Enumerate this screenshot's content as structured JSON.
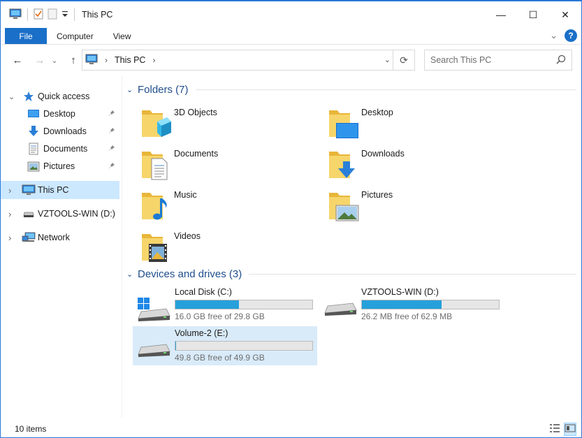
{
  "window": {
    "title": "This PC",
    "controls": {
      "minimize": "—",
      "maximize": "☐",
      "close": "✕"
    }
  },
  "ribbon": {
    "tabs": [
      "File",
      "Computer",
      "View"
    ],
    "expand_glyph": "⌄",
    "help_glyph": "?"
  },
  "nav": {
    "back": "←",
    "forward": "→",
    "recent": "⌄",
    "up": "↑",
    "address_crumb": "This PC",
    "address_dropdown": "⌄",
    "refresh": "⟳",
    "search_placeholder": "Search This PC"
  },
  "sidebar": {
    "items": [
      {
        "label": "Quick access",
        "icon": "star-icon",
        "chevron": "⌄",
        "pinned": false
      },
      {
        "label": "Desktop",
        "icon": "desktop-icon",
        "chevron": "",
        "pinned": true
      },
      {
        "label": "Downloads",
        "icon": "download-icon",
        "chevron": "",
        "pinned": true
      },
      {
        "label": "Documents",
        "icon": "document-icon",
        "chevron": "",
        "pinned": true
      },
      {
        "label": "Pictures",
        "icon": "pictures-icon",
        "chevron": "",
        "pinned": true
      },
      {
        "label": "This PC",
        "icon": "computer-icon",
        "chevron": "›",
        "pinned": false,
        "selected": true
      },
      {
        "label": "VZTOOLS-WIN (D:)",
        "icon": "drive-icon",
        "chevron": "›",
        "pinned": false
      },
      {
        "label": "Network",
        "icon": "network-icon",
        "chevron": "›",
        "pinned": false
      }
    ],
    "pin_glyph": "📌"
  },
  "content": {
    "folders_header": "Folders (7)",
    "folders": [
      {
        "label": "3D Objects",
        "icon": "3d-objects-icon"
      },
      {
        "label": "Desktop",
        "icon": "desktop-folder-icon"
      },
      {
        "label": "Documents",
        "icon": "documents-folder-icon"
      },
      {
        "label": "Downloads",
        "icon": "downloads-folder-icon"
      },
      {
        "label": "Music",
        "icon": "music-folder-icon"
      },
      {
        "label": "Pictures",
        "icon": "pictures-folder-icon"
      },
      {
        "label": "Videos",
        "icon": "videos-folder-icon"
      }
    ],
    "drives_header": "Devices and drives (3)",
    "drives": [
      {
        "label": "Local Disk (C:)",
        "free_text": "16.0 GB free of 29.8 GB",
        "used_fraction": 0.463,
        "windows": true
      },
      {
        "label": "VZTOOLS-WIN (D:)",
        "free_text": "26.2 MB free of 62.9 MB",
        "used_fraction": 0.583,
        "windows": false
      },
      {
        "label": "Volume-2 (E:)",
        "free_text": "49.8 GB free of 49.9 GB",
        "used_fraction": 0.002,
        "windows": false,
        "selected": true
      }
    ]
  },
  "status": {
    "item_count": "10 items"
  },
  "colors": {
    "accent": "#1a6fc8",
    "selection": "#cce8ff",
    "drive_bar": "#26a0da",
    "header_text": "#1f4e8c",
    "folder_yellow": "#f4c94f"
  }
}
